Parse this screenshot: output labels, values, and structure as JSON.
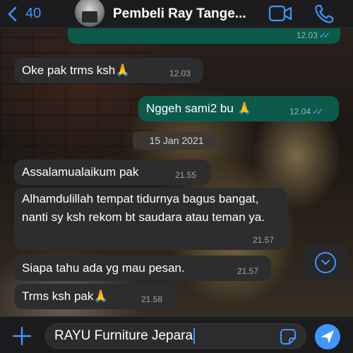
{
  "header": {
    "back_count": "40",
    "contact_name": "Pembeli Ray Tange..."
  },
  "messages": [
    {
      "direction": "out",
      "text": "",
      "time": "12.03",
      "read": true
    },
    {
      "direction": "in",
      "text": "Oke pak trms ksh🙏",
      "time": "12.03"
    },
    {
      "direction": "out",
      "text": "Nggeh sami2 bu 🙏",
      "time": "12.04",
      "read": true
    },
    {
      "direction": "in",
      "text": "Assalamualaikum pak",
      "time": "21.55"
    },
    {
      "direction": "in",
      "text": "Alhamdulillah tempat tidurnya bagus bangat, nanti sy ksh rekom bt saudara atau teman ya.",
      "time": "21.57"
    },
    {
      "direction": "in",
      "text": "Siapa tahu ada yg mau pesan.",
      "time": "21.57"
    },
    {
      "direction": "in",
      "text": "Trms ksh pak🙏",
      "time": "21.58"
    }
  ],
  "date_separator": "15 Jan 2021",
  "composer": {
    "value": "RAYU Furniture Jepara"
  },
  "colors": {
    "accent": "#3e96ff",
    "outgoing_bubble": "#0c5a4c",
    "incoming_bubble": "#2d2d2f"
  },
  "icons": {
    "back": "chevron-left-icon",
    "video": "video-camera-icon",
    "phone": "phone-icon",
    "add": "plus-icon",
    "sticker": "sticker-icon",
    "send": "send-arrow-icon",
    "scroll": "chevron-down-icon"
  }
}
